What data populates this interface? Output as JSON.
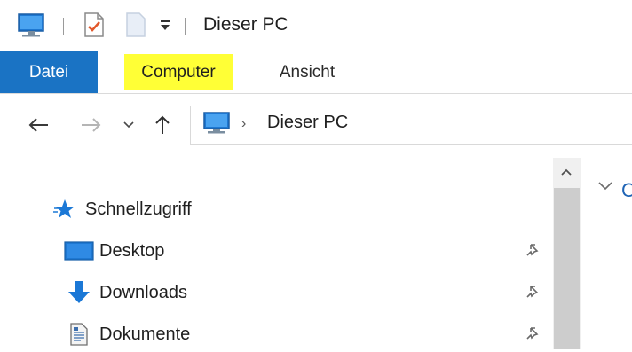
{
  "window": {
    "title": "Dieser PC"
  },
  "quick_access": {
    "icons": [
      "computer-icon",
      "properties-icon",
      "new-folder-icon",
      "customize-dropdown-icon"
    ]
  },
  "ribbon": {
    "tabs": [
      {
        "label": "Datei",
        "active_color": "#1a73c4"
      },
      {
        "label": "Computer",
        "highlight_color": "#ffff36"
      },
      {
        "label": "Ansicht"
      }
    ]
  },
  "address": {
    "icons": [
      "back-arrow-icon",
      "forward-arrow-icon",
      "recent-dropdown-icon",
      "up-arrow-icon",
      "computer-icon",
      "breadcrumb-chevron-icon"
    ],
    "breadcrumb": [
      "Dieser PC"
    ],
    "separator": "›"
  },
  "navigation": {
    "quick_access_label": "Schnellzugriff",
    "items": [
      {
        "label": "Desktop",
        "icon": "desktop-icon",
        "pinned": true
      },
      {
        "label": "Downloads",
        "icon": "download-arrow-icon",
        "pinned": true
      },
      {
        "label": "Dokumente",
        "icon": "document-icon",
        "pinned": true
      }
    ]
  },
  "content": {
    "group_partial_label": "C"
  },
  "colors": {
    "accent": "#1a73c4",
    "highlight": "#ffff36",
    "link": "#1f64b5"
  }
}
